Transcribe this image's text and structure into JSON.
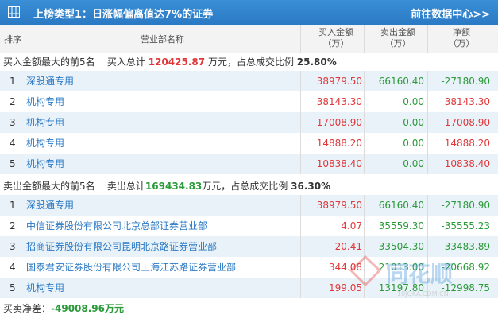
{
  "header": {
    "title": "上榜类型1：日涨幅偏离值达7%的证券",
    "link": "前往数据中心>>"
  },
  "columns": {
    "rank": "排序",
    "dept": "营业部名称",
    "buy_line1": "买入金额",
    "buy_line2": "（万）",
    "sell_line1": "卖出金额",
    "sell_line2": "（万）",
    "net_line1": "净额",
    "net_line2": "（万）"
  },
  "buy_section": {
    "label": "买入金额最大的前5名",
    "total_label": "买入总计",
    "total_value": "120425.87",
    "unit": "万元，占总成交比例",
    "ratio": "25.80%"
  },
  "buy_rows": [
    {
      "rank": "1",
      "dept": "深股通专用",
      "buy": "38979.50",
      "sell": "66160.40",
      "net": "-27180.90"
    },
    {
      "rank": "2",
      "dept": "机构专用",
      "buy": "38143.30",
      "sell": "0.00",
      "net": "38143.30"
    },
    {
      "rank": "3",
      "dept": "机构专用",
      "buy": "17008.90",
      "sell": "0.00",
      "net": "17008.90"
    },
    {
      "rank": "4",
      "dept": "机构专用",
      "buy": "14888.20",
      "sell": "0.00",
      "net": "14888.20"
    },
    {
      "rank": "5",
      "dept": "机构专用",
      "buy": "10838.40",
      "sell": "0.00",
      "net": "10838.40"
    }
  ],
  "sell_section": {
    "label": "卖出金额最大的前5名",
    "total_label": "卖出总计",
    "total_value": "169434.83",
    "unit": "万元，占总成交比例",
    "ratio": "36.30%"
  },
  "sell_rows": [
    {
      "rank": "1",
      "dept": "深股通专用",
      "buy": "38979.50",
      "sell": "66160.40",
      "net": "-27180.90"
    },
    {
      "rank": "2",
      "dept": "中信证券股份有限公司北京总部证券营业部",
      "buy": "4.07",
      "sell": "35559.30",
      "net": "-35555.23"
    },
    {
      "rank": "3",
      "dept": "招商证券股份有限公司昆明北京路证券营业部",
      "buy": "20.41",
      "sell": "33504.30",
      "net": "-33483.89"
    },
    {
      "rank": "4",
      "dept": "国泰君安证券股份有限公司上海江苏路证券营业部",
      "buy": "344.08",
      "sell": "21013.00",
      "net": "-20668.92"
    },
    {
      "rank": "5",
      "dept": "机构专用",
      "buy": "199.05",
      "sell": "13197.80",
      "net": "-12998.75"
    }
  ],
  "footer": {
    "label": "买卖净差：",
    "value": "-49008.96万元"
  },
  "watermark": {
    "text": "同花顺",
    "sub": "10JQKA.COM.CN"
  },
  "colors": {
    "header_bg": "#2a79c4",
    "red": "#e0383a",
    "green": "#2a9a3a",
    "link": "#2a79c4",
    "row_alt": "#e9f2f8"
  }
}
